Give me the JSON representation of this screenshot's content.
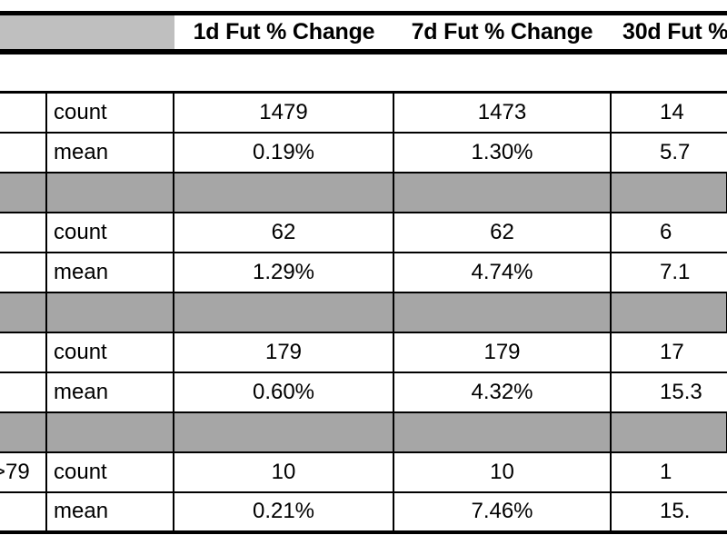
{
  "header": {
    "corner_label": "",
    "columns": [
      "1d Fut % Change",
      "7d Fut % Change",
      "30d Fut %"
    ]
  },
  "table": {
    "groups": [
      {
        "index_label": "",
        "rows": [
          {
            "stat": "count",
            "values": [
              "1479",
              "1473",
              "14"
            ]
          },
          {
            "stat": "mean",
            "values": [
              "0.19%",
              "1.30%",
              "5.7"
            ]
          }
        ]
      },
      {
        "index_label": "",
        "rows": [
          {
            "stat": "count",
            "values": [
              "62",
              "62",
              "6"
            ]
          },
          {
            "stat": "mean",
            "values": [
              "1.29%",
              "4.74%",
              "7.1"
            ]
          }
        ]
      },
      {
        "index_label": "",
        "rows": [
          {
            "stat": "count",
            "values": [
              "179",
              "179",
              "17"
            ]
          },
          {
            "stat": "mean",
            "values": [
              "0.60%",
              "4.32%",
              "15.3"
            ]
          }
        ]
      },
      {
        "index_label": ">79",
        "rows": [
          {
            "stat": "count",
            "values": [
              "10",
              "10",
              "1"
            ]
          },
          {
            "stat": "mean",
            "values": [
              "0.21%",
              "7.46%",
              "15."
            ]
          }
        ]
      }
    ]
  },
  "colors": {
    "grid_line": "#000000",
    "spacer_fill": "#a6a6a6",
    "header_corner_fill": "#bfbfbf",
    "cell_background": "#ffffff",
    "text": "#000000"
  }
}
